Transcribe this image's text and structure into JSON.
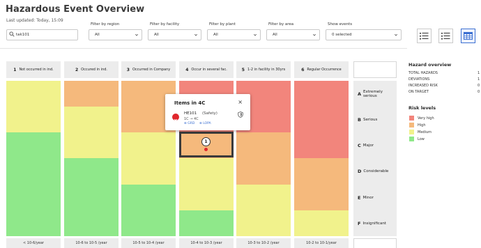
{
  "header": {
    "title": "Hazardous Event Overview",
    "last_updated": "Last updated: Today, 15:09"
  },
  "search": {
    "value": "tak101",
    "placeholder": ""
  },
  "filters": {
    "region": {
      "label": "Filter by region",
      "value": "All"
    },
    "facility": {
      "label": "Filter by facility",
      "value": "All"
    },
    "plant": {
      "label": "Filter by plant",
      "value": "All"
    },
    "area": {
      "label": "Filter by area",
      "value": "All"
    },
    "events": {
      "label": "Show events",
      "value": "0 selected"
    }
  },
  "view_buttons": [
    {
      "name": "list-small-view",
      "icon": "list-icon"
    },
    {
      "name": "list-view",
      "icon": "list-icon"
    },
    {
      "name": "table-view",
      "icon": "table-icon",
      "active": true
    }
  ],
  "matrix": {
    "columns": [
      {
        "num": "1",
        "label": "Not occurred in ind."
      },
      {
        "num": "2",
        "label": "Occured in ind."
      },
      {
        "num": "3",
        "label": "Occurred in Company"
      },
      {
        "num": "4",
        "label": "Occur in several fac."
      },
      {
        "num": "5",
        "label": "1-2 in facility in 30yrs"
      },
      {
        "num": "6",
        "label": "Regular Occurrence"
      }
    ],
    "rows": [
      {
        "letter": "A",
        "label": "Extremely serious"
      },
      {
        "letter": "B",
        "label": "Serious"
      },
      {
        "letter": "C",
        "label": "Major"
      },
      {
        "letter": "D",
        "label": "Considerable"
      },
      {
        "letter": "E",
        "label": "Minor"
      },
      {
        "letter": "F",
        "label": "Insignificant"
      }
    ],
    "frequencies": [
      "< 10-6/year",
      "10-6 to 10-5 /year",
      "10-5 to 10-4 /year",
      "10-4 to 10-3 /year",
      "10-3 to 10-2 /year",
      "10-2 to 10-1/year"
    ],
    "levels": [
      [
        "medium",
        "high",
        "high",
        "very_high",
        "very_high",
        "very_high"
      ],
      [
        "medium",
        "medium",
        "high",
        "very_high",
        "very_high",
        "very_high"
      ],
      [
        "low",
        "medium",
        "medium",
        "high",
        "high",
        "very_high"
      ],
      [
        "low",
        "low",
        "medium",
        "medium",
        "high",
        "high"
      ],
      [
        "low",
        "low",
        "low",
        "medium",
        "medium",
        "high"
      ],
      [
        "low",
        "low",
        "low",
        "low",
        "medium",
        "medium"
      ]
    ],
    "selected_cell": {
      "row": 2,
      "col": 3,
      "count": "1"
    }
  },
  "popup": {
    "title": "Items in 4C",
    "close": "×",
    "item_id": "HE101",
    "item_category": "(Safety)",
    "item_cell": "1C → 4C",
    "tag_grd": "GRD",
    "tag_lopa": "LOPA"
  },
  "overview": {
    "title": "Hazard overview",
    "stats": [
      {
        "label": "TOTAL HAZARDS",
        "value": "1"
      },
      {
        "label": "DEVIATIONS",
        "value": "1"
      },
      {
        "label": "INCREASED RISK",
        "value": "0"
      },
      {
        "label": "ON TARGET",
        "value": "0"
      }
    ]
  },
  "risk_levels": {
    "title": "Risk levels",
    "items": [
      {
        "key": "very_high",
        "label": "Very high"
      },
      {
        "key": "high",
        "label": "High"
      },
      {
        "key": "medium",
        "label": "Medium"
      },
      {
        "key": "low",
        "label": "Low"
      }
    ]
  },
  "colors": {
    "very_high": "#f2857c",
    "high": "#f5b97c",
    "medium": "#f1f28c",
    "low": "#8fe88a",
    "accent": "#3b6fd1",
    "error": "#e0272d"
  }
}
